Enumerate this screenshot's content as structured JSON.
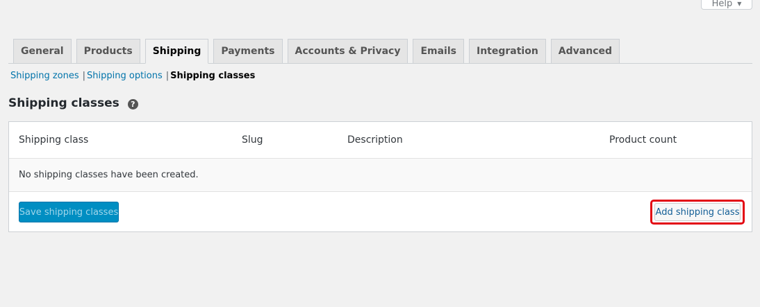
{
  "help": {
    "label": "Help"
  },
  "tabs": [
    {
      "label": "General"
    },
    {
      "label": "Products"
    },
    {
      "label": "Shipping"
    },
    {
      "label": "Payments"
    },
    {
      "label": "Accounts & Privacy"
    },
    {
      "label": "Emails"
    },
    {
      "label": "Integration"
    },
    {
      "label": "Advanced"
    }
  ],
  "subnav": {
    "zones": "Shipping zones",
    "options": "Shipping options",
    "classes": "Shipping classes",
    "separator": "|"
  },
  "section": {
    "title": "Shipping classes",
    "help_glyph": "?"
  },
  "table": {
    "columns": [
      "Shipping class",
      "Slug",
      "Description",
      "Product count"
    ],
    "empty_message": "No shipping classes have been created."
  },
  "footer": {
    "save_label": "Save shipping classes",
    "add_label": "Add shipping class"
  },
  "colors": {
    "primary": "#008ec2",
    "link": "#0073aa",
    "highlight": "#e30613"
  },
  "icons": {
    "help_tab_caret": "caret-down-icon",
    "section_help": "question-circle-icon"
  }
}
